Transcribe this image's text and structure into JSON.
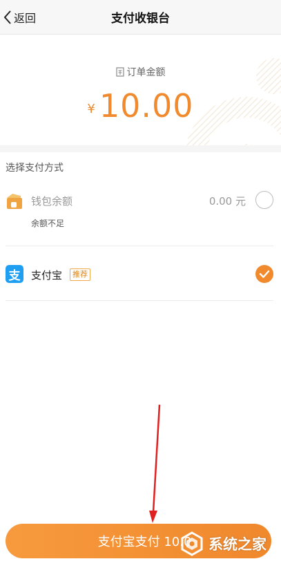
{
  "nav": {
    "back_label": "返回",
    "title": "支付收银台"
  },
  "order": {
    "label": "订单金额",
    "currency": "¥",
    "amount": "10.00"
  },
  "payment": {
    "section_title": "选择支付方式",
    "wallet": {
      "name": "钱包余额",
      "balance": "0.00 元",
      "note": "余额不足",
      "selected": false
    },
    "alipay": {
      "name": "支付宝",
      "badge": "推荐",
      "icon_char": "支",
      "selected": true
    }
  },
  "pay_button": {
    "label": "支付宝支付 10.0"
  },
  "watermark": {
    "text": "系统之家"
  },
  "colors": {
    "accent": "#f08a2c",
    "alipay_blue": "#1e9ff2",
    "annotation_arrow": "#e0201f"
  }
}
